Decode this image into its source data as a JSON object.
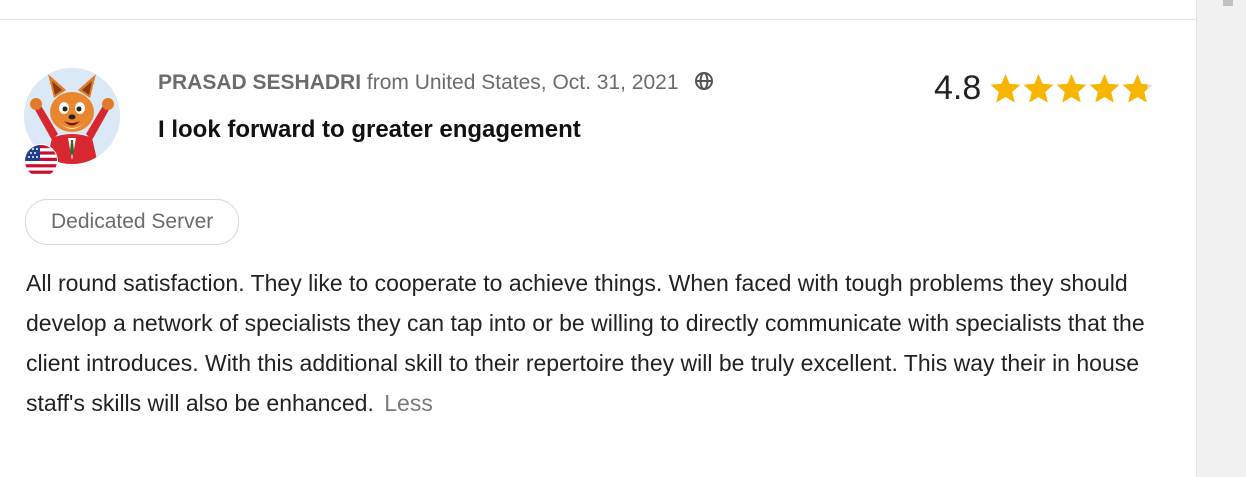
{
  "review": {
    "reviewer_name": "PRASAD SESHADRI",
    "origin": " from United States, Oct. 31, 2021",
    "title": "I look forward to greater engagement",
    "rating": "4.8",
    "rating_value": 4.8,
    "rating_max": 5,
    "tag": "Dedicated Server",
    "text": "All round satisfaction. They like to cooperate to achieve things. When faced with tough problems they should develop a network of specialists they can tap into or be willing to directly communicate with specialists that the client introduces. With this additional skill to their repertoire they will be truly excellent. This way their in house staff's skills will also be enhanced.",
    "less_label": "Less"
  },
  "icons": {
    "avatar": "fox-avatar-icon",
    "flag": "us-flag-icon",
    "translate": "globe-icon",
    "star": "star-icon"
  },
  "colors": {
    "star": "#f7b500",
    "star_empty": "#d9d9d9",
    "avatar_bg": "#dbe9f6"
  }
}
